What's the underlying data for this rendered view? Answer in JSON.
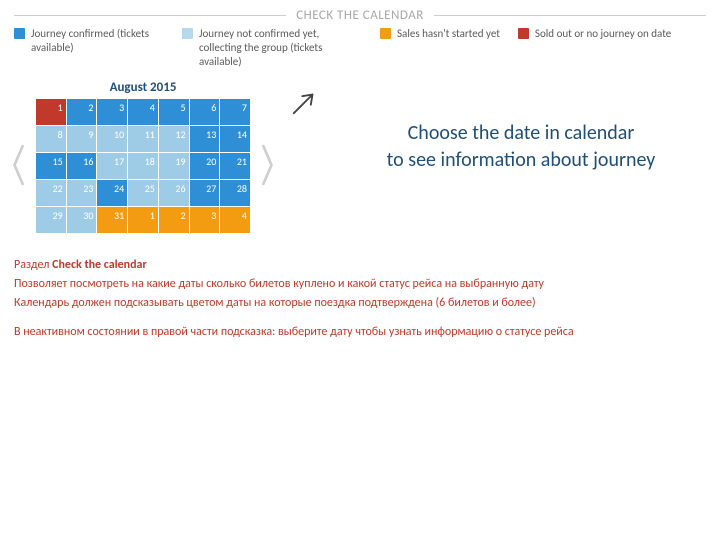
{
  "header": {
    "title": "CHECK THE CALENDAR"
  },
  "legend": {
    "confirmed": "Journey confirmed (tickets available)",
    "pending": "Journey not confirmed yet, collecting the group (tickets available)",
    "sales": "Sales hasn't started yet",
    "soldout": "Sold out or no journey on date"
  },
  "calendar": {
    "title": "August 2015",
    "cells": [
      {
        "n": "1",
        "s": "soldout"
      },
      {
        "n": "2",
        "s": "confirmed"
      },
      {
        "n": "3",
        "s": "confirmed"
      },
      {
        "n": "4",
        "s": "confirmed"
      },
      {
        "n": "5",
        "s": "confirmed"
      },
      {
        "n": "6",
        "s": "confirmed"
      },
      {
        "n": "7",
        "s": "confirmed"
      },
      {
        "n": "8",
        "s": "pending"
      },
      {
        "n": "9",
        "s": "pending"
      },
      {
        "n": "10",
        "s": "pending"
      },
      {
        "n": "11",
        "s": "pending"
      },
      {
        "n": "12",
        "s": "pending"
      },
      {
        "n": "13",
        "s": "confirmed"
      },
      {
        "n": "14",
        "s": "confirmed"
      },
      {
        "n": "15",
        "s": "confirmed"
      },
      {
        "n": "16",
        "s": "confirmed"
      },
      {
        "n": "17",
        "s": "pending"
      },
      {
        "n": "18",
        "s": "pending"
      },
      {
        "n": "19",
        "s": "pending"
      },
      {
        "n": "20",
        "s": "confirmed"
      },
      {
        "n": "21",
        "s": "confirmed"
      },
      {
        "n": "22",
        "s": "pending"
      },
      {
        "n": "23",
        "s": "pending"
      },
      {
        "n": "24",
        "s": "confirmed"
      },
      {
        "n": "25",
        "s": "pending"
      },
      {
        "n": "26",
        "s": "pending"
      },
      {
        "n": "27",
        "s": "confirmed"
      },
      {
        "n": "28",
        "s": "confirmed"
      },
      {
        "n": "29",
        "s": "pending"
      },
      {
        "n": "30",
        "s": "pending"
      },
      {
        "n": "31",
        "s": "sales"
      },
      {
        "n": "1",
        "s": "sales"
      },
      {
        "n": "2",
        "s": "sales"
      },
      {
        "n": "3",
        "s": "sales"
      },
      {
        "n": "4",
        "s": "sales"
      }
    ]
  },
  "info": {
    "line1": "Choose the date in calendar",
    "line2": "to see information about journey"
  },
  "notes": {
    "l1a": "Раздел ",
    "l1b": "Check the calendar",
    "l2": "Позволяет посмотреть на какие даты сколько билетов куплено и какой статус рейса на выбранную дату",
    "l3": "Календарь должен подсказывать цветом даты на которые поездка подтверждена (6 билетов и более)",
    "l4": "В неактивном состоянии в правой части подсказка: выберите дату чтобы узнать информацию о статусе рейса"
  }
}
